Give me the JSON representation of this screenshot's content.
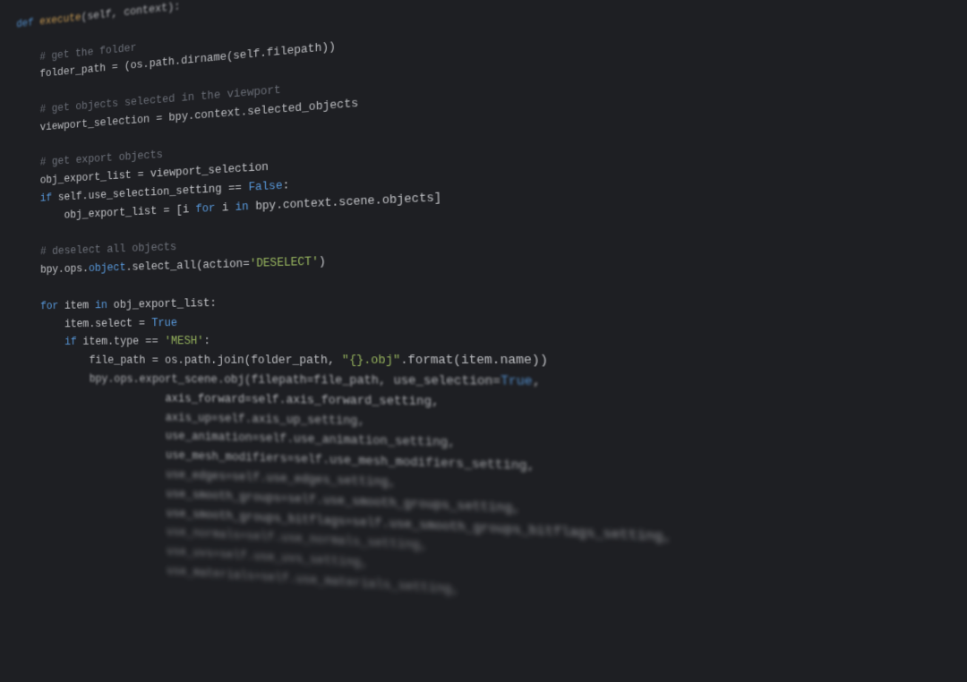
{
  "code": {
    "lines": [
      {
        "indent": 0,
        "cls": "blur2",
        "tokens": [
          {
            "t": "def ",
            "c": "kw"
          },
          {
            "t": "execute",
            "c": "fn"
          },
          {
            "t": "(self, context):",
            "c": ""
          }
        ]
      },
      {
        "indent": 0,
        "cls": "blur2",
        "tokens": [
          {
            "t": " ",
            "c": ""
          }
        ]
      },
      {
        "indent": 1,
        "cls": "blur1",
        "tokens": [
          {
            "t": "# get the folder",
            "c": "cm"
          }
        ]
      },
      {
        "indent": 1,
        "cls": "blur1",
        "tokens": [
          {
            "t": "folder_path = (os.path.dirname(self.filepath))",
            "c": ""
          }
        ]
      },
      {
        "indent": 0,
        "cls": "blur1",
        "tokens": [
          {
            "t": " ",
            "c": ""
          }
        ]
      },
      {
        "indent": 1,
        "cls": "blur1",
        "tokens": [
          {
            "t": "# get objects selected in the viewport",
            "c": "cm"
          }
        ]
      },
      {
        "indent": 1,
        "cls": "blur1",
        "tokens": [
          {
            "t": "viewport_selection = bpy.context.selected_objects",
            "c": ""
          }
        ]
      },
      {
        "indent": 0,
        "cls": "",
        "tokens": [
          {
            "t": " ",
            "c": ""
          }
        ]
      },
      {
        "indent": 1,
        "cls": "",
        "tokens": [
          {
            "t": "# get export objects",
            "c": "cm"
          }
        ]
      },
      {
        "indent": 1,
        "cls": "",
        "tokens": [
          {
            "t": "obj_export_list = viewport_selection",
            "c": ""
          }
        ]
      },
      {
        "indent": 1,
        "cls": "",
        "tokens": [
          {
            "t": "if",
            "c": "kw"
          },
          {
            "t": " self.use_selection_setting == ",
            "c": ""
          },
          {
            "t": "False",
            "c": "lit"
          },
          {
            "t": ":",
            "c": ""
          }
        ]
      },
      {
        "indent": 2,
        "cls": "",
        "tokens": [
          {
            "t": "obj_export_list = [i ",
            "c": ""
          },
          {
            "t": "for",
            "c": "kw"
          },
          {
            "t": " i ",
            "c": ""
          },
          {
            "t": "in",
            "c": "kw"
          },
          {
            "t": " bpy.context.scene.objects]",
            "c": ""
          }
        ]
      },
      {
        "indent": 0,
        "cls": "",
        "tokens": [
          {
            "t": " ",
            "c": ""
          }
        ]
      },
      {
        "indent": 1,
        "cls": "",
        "tokens": [
          {
            "t": "# deselect all objects",
            "c": "cm"
          }
        ]
      },
      {
        "indent": 1,
        "cls": "",
        "tokens": [
          {
            "t": "bpy.ops.",
            "c": ""
          },
          {
            "t": "object",
            "c": "kw"
          },
          {
            "t": ".select_all(action=",
            "c": ""
          },
          {
            "t": "'DESELECT'",
            "c": "st"
          },
          {
            "t": ")",
            "c": ""
          }
        ]
      },
      {
        "indent": 0,
        "cls": "",
        "tokens": [
          {
            "t": " ",
            "c": ""
          }
        ]
      },
      {
        "indent": 1,
        "cls": "",
        "tokens": [
          {
            "t": "for",
            "c": "kw"
          },
          {
            "t": " item ",
            "c": ""
          },
          {
            "t": "in",
            "c": "kw"
          },
          {
            "t": " obj_export_list:",
            "c": ""
          }
        ]
      },
      {
        "indent": 2,
        "cls": "",
        "tokens": [
          {
            "t": "item.select = ",
            "c": ""
          },
          {
            "t": "True",
            "c": "lit"
          }
        ]
      },
      {
        "indent": 2,
        "cls": "blur1",
        "tokens": [
          {
            "t": "if",
            "c": "kw"
          },
          {
            "t": " item.type == ",
            "c": ""
          },
          {
            "t": "'MESH'",
            "c": "st"
          },
          {
            "t": ":",
            "c": ""
          }
        ]
      },
      {
        "indent": 3,
        "cls": "blur1",
        "tokens": [
          {
            "t": "file_path = os.path.join(folder_path, ",
            "c": ""
          },
          {
            "t": "\"{}.obj\"",
            "c": "st"
          },
          {
            "t": ".format(item.name))",
            "c": ""
          }
        ]
      },
      {
        "indent": 3,
        "cls": "blur2",
        "tokens": [
          {
            "t": "bpy.ops.export_scene.obj(filepath=file_path, use_selection=",
            "c": ""
          },
          {
            "t": "True",
            "c": "lit"
          },
          {
            "t": ",",
            "c": ""
          }
        ]
      },
      {
        "indent": 6,
        "cls": "blur2",
        "tokens": [
          {
            "t": "axis_forward=self.axis_forward_setting,",
            "c": ""
          }
        ]
      },
      {
        "indent": 6,
        "cls": "blur3",
        "tokens": [
          {
            "t": "axis_up=self.axis_up_setting,",
            "c": ""
          }
        ]
      },
      {
        "indent": 6,
        "cls": "blur3",
        "tokens": [
          {
            "t": "use_animation=self.use_animation_setting,",
            "c": ""
          }
        ]
      },
      {
        "indent": 6,
        "cls": "blur3",
        "tokens": [
          {
            "t": "use_mesh_modifiers=self.use_mesh_modifiers_setting,",
            "c": ""
          }
        ]
      },
      {
        "indent": 6,
        "cls": "blur4",
        "tokens": [
          {
            "t": "use_edges=self.use_edges_setting,",
            "c": ""
          }
        ]
      },
      {
        "indent": 6,
        "cls": "blur4",
        "tokens": [
          {
            "t": "use_smooth_groups=self.use_smooth_groups_setting,",
            "c": ""
          }
        ]
      },
      {
        "indent": 6,
        "cls": "blur4",
        "tokens": [
          {
            "t": "use_smooth_groups_bitflags=self.use_smooth_groups_bitflags_setting,",
            "c": ""
          }
        ]
      },
      {
        "indent": 6,
        "cls": "blur5",
        "tokens": [
          {
            "t": "use_normals=self.use_normals_setting,",
            "c": ""
          }
        ]
      },
      {
        "indent": 6,
        "cls": "blur5",
        "tokens": [
          {
            "t": "use_uvs=self.use_uvs_setting,",
            "c": ""
          }
        ]
      },
      {
        "indent": 6,
        "cls": "blur5",
        "tokens": [
          {
            "t": "use_materials=self.use_materials_setting,",
            "c": ""
          }
        ]
      }
    ],
    "indent_unit": "    "
  }
}
